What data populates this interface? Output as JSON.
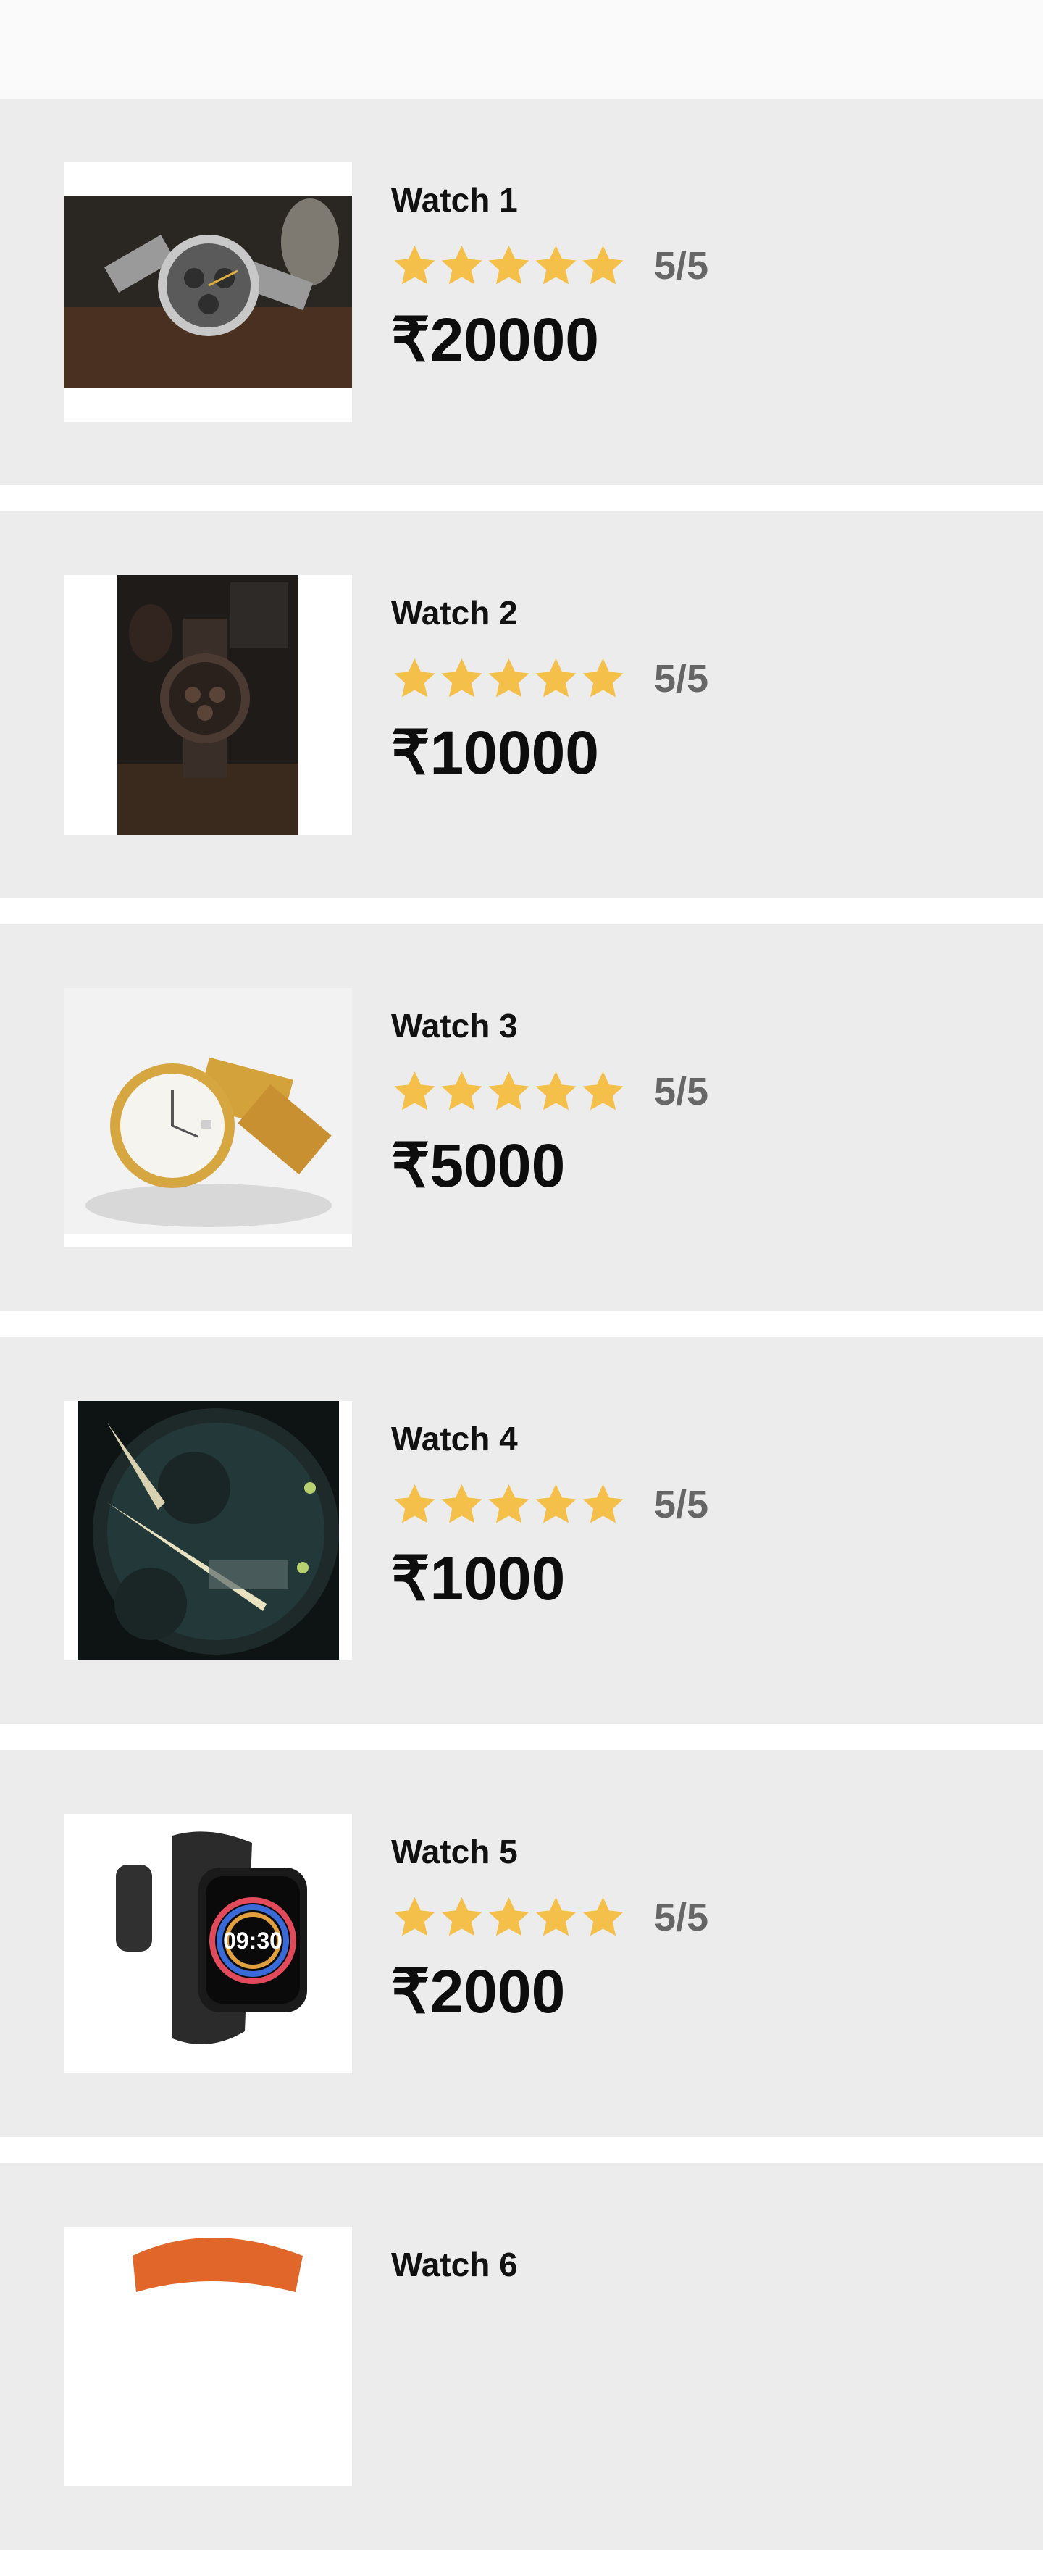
{
  "products": [
    {
      "title": "Watch 1",
      "rating": "5/5",
      "stars": 5,
      "price": "₹20000",
      "image": "silver-chronograph-watch-photo"
    },
    {
      "title": "Watch 2",
      "rating": "5/5",
      "stars": 5,
      "price": "₹10000",
      "image": "dark-bronze-watch-photo"
    },
    {
      "title": "Watch 3",
      "rating": "5/5",
      "stars": 5,
      "price": "₹5000",
      "image": "gold-watch-photo"
    },
    {
      "title": "Watch 4",
      "rating": "5/5",
      "stars": 5,
      "price": "₹1000",
      "image": "watch-dial-closeup-photo"
    },
    {
      "title": "Watch 5",
      "rating": "5/5",
      "stars": 5,
      "price": "₹2000",
      "image": "black-smartwatch-photo",
      "smartwatch_time": "09:30"
    },
    {
      "title": "Watch 6",
      "image": "orange-strap-watch-photo"
    }
  ],
  "colors": {
    "card_background": "#ececec",
    "star": "#f4c04a",
    "rating_text": "#666666",
    "price_text": "#0d0d0d"
  },
  "icons": {
    "rating_star": "star-icon"
  }
}
